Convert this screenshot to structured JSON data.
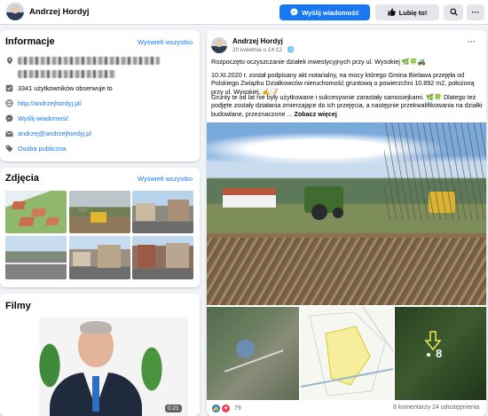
{
  "header": {
    "name": "Andrzej Hordyj",
    "message_button": "Wyślij wiadomość",
    "like_button": "Lubię to!",
    "search_icon": "search-icon",
    "more_icon": "more-icon"
  },
  "info": {
    "title": "Informacje",
    "see_all": "Wyświetl wszystko",
    "followers": "3341 użytkowników obserwuje to",
    "website": "http://andrzejhordyj.pl/",
    "send_message": "Wyślij wiadomość",
    "email": "andrzej@andrzejhordyj.pl",
    "category": "Osoba publiczna"
  },
  "photos": {
    "title": "Zdjęcia",
    "see_all": "Wyświetl wszystko"
  },
  "films": {
    "title": "Filmy",
    "duration": "0:21"
  },
  "post": {
    "author": "Andrzej Hordyj",
    "date": "20 kwietnia o 14:12 · 🌐",
    "line1": "Rozpoczęto oczyszczanie działek inwestycyjnych przy ul. Wysokiej 🌿🍀🚜",
    "para2": "10.XI.2020 r. został podpisany akt notarialny, na mocy którego Gmina Bielawa przejęła od Polskiego Związku Działkowców nieruchomość gruntową o powierzchni 10.892 m2, położoną przy ul. Wysokiej. ✍️📝",
    "para3": "Grunty te od lat nie były użytkowane i sukcesywnie zarastały samosiejkami. 🌿🍀 Dlatego też podjęte zostały działania zmierzające do ich przejęcia, a następnie przekwalifikowania na działki budowlane, przeznaczone ...",
    "see_more": "Zobacz więcej",
    "map_marker": "8",
    "reactions_count": "79",
    "comments": "8 komentarzy",
    "shares": "24 udostępnienia"
  }
}
